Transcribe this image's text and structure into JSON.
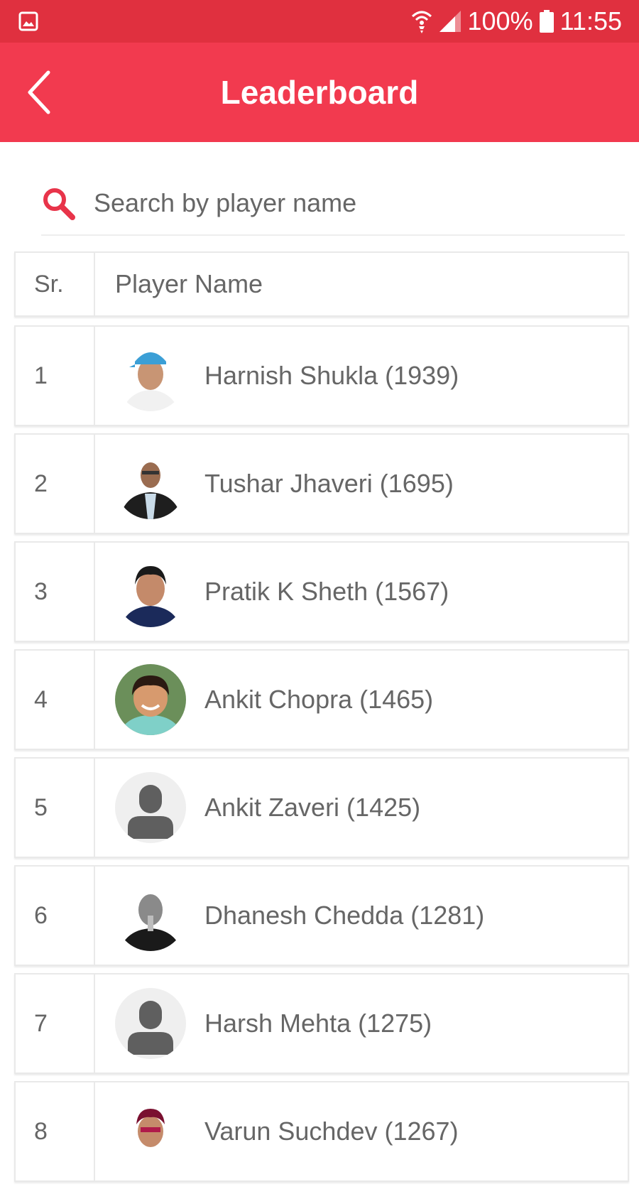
{
  "status_bar": {
    "battery": "100%",
    "time": "11:55",
    "icons": [
      "gallery-icon",
      "wifi-icon",
      "signal-icon",
      "battery-icon"
    ],
    "color": "#e0303f"
  },
  "app_bar": {
    "title": "Leaderboard",
    "back_icon": "back-arrow-icon",
    "color": "#f23a4f"
  },
  "search": {
    "placeholder": "Search by player name",
    "value": "",
    "icon": "search-icon"
  },
  "table": {
    "headers": {
      "sr": "Sr.",
      "name": "Player Name"
    },
    "rows": [
      {
        "sr": "1",
        "name": "Harnish Shukla (1939)",
        "avatar": "photo"
      },
      {
        "sr": "2",
        "name": "Tushar Jhaveri (1695)",
        "avatar": "photo"
      },
      {
        "sr": "3",
        "name": "Pratik K Sheth (1567)",
        "avatar": "photo"
      },
      {
        "sr": "4",
        "name": "Ankit Chopra (1465)",
        "avatar": "photo"
      },
      {
        "sr": "5",
        "name": "Ankit Zaveri (1425)",
        "avatar": "placeholder"
      },
      {
        "sr": "6",
        "name": "Dhanesh Chedda (1281)",
        "avatar": "photo"
      },
      {
        "sr": "7",
        "name": "Harsh Mehta (1275)",
        "avatar": "placeholder"
      },
      {
        "sr": "8",
        "name": "Varun Suchdev (1267)",
        "avatar": "photo"
      }
    ]
  }
}
